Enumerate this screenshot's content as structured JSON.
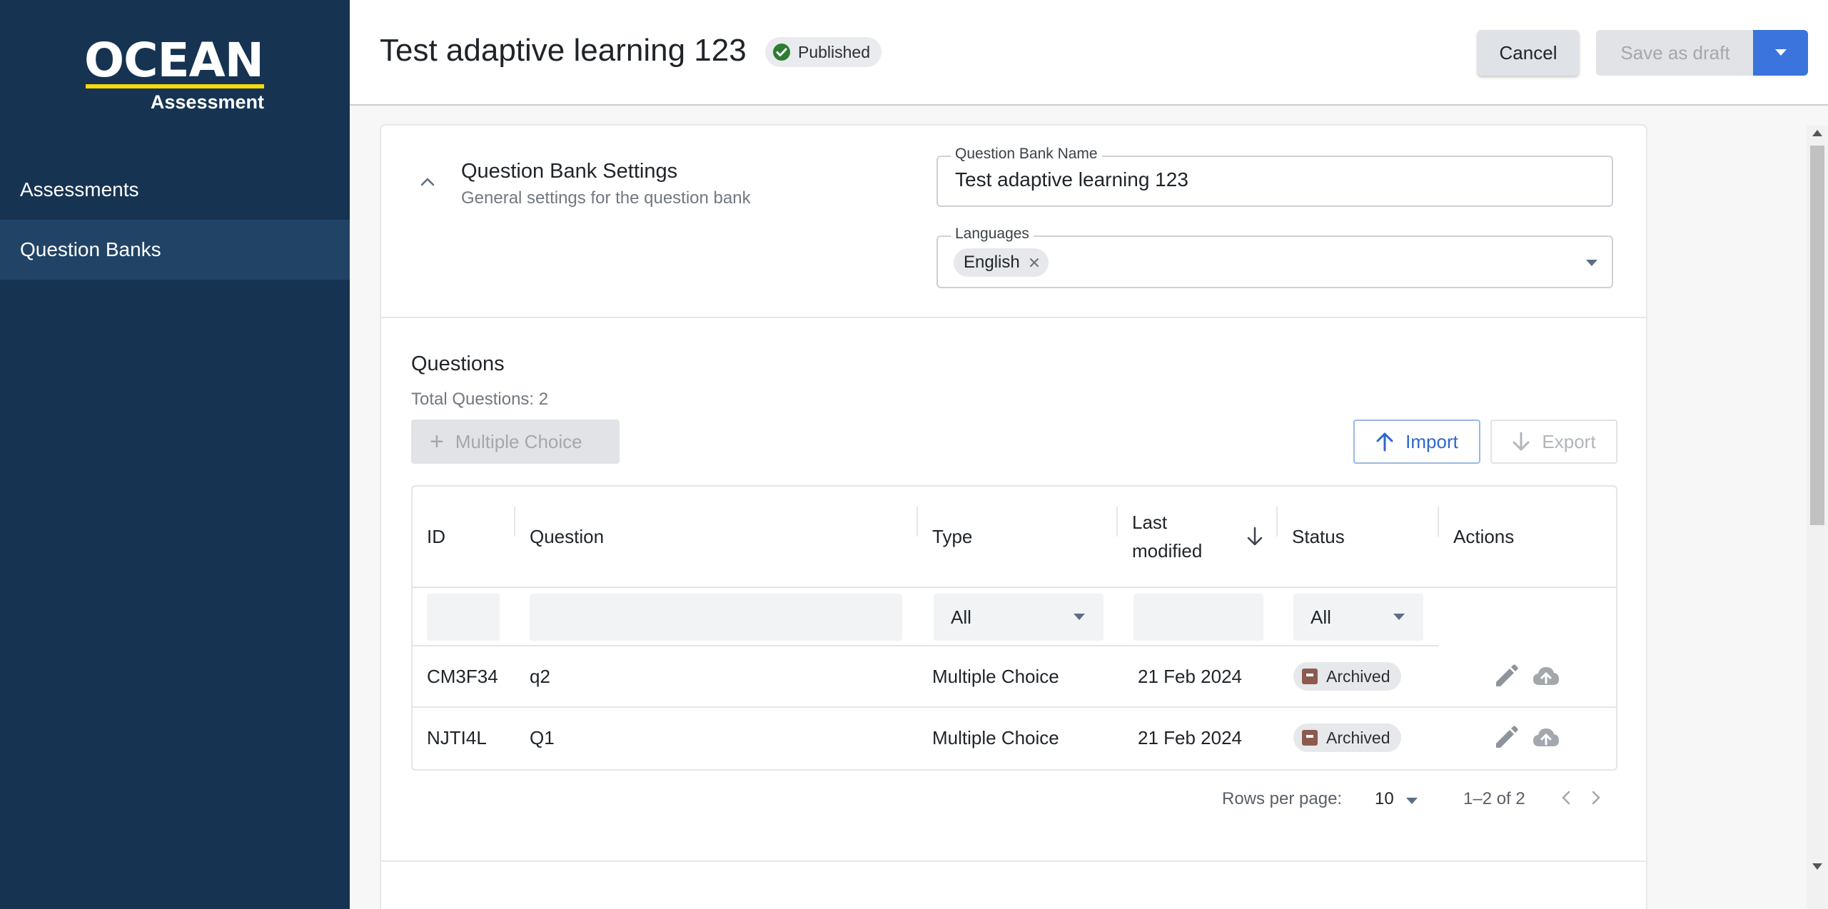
{
  "brand": {
    "name": "OCEAN",
    "sub": "Assessment",
    "accent": "#f5d90b"
  },
  "sidebar": {
    "items": [
      {
        "label": "Assessments",
        "active": false
      },
      {
        "label": "Question Banks",
        "active": true
      }
    ]
  },
  "header": {
    "title": "Test adaptive learning 123",
    "status": "Published",
    "cancel_label": "Cancel",
    "draft_label": "Save as draft"
  },
  "settings": {
    "title": "Question Bank Settings",
    "subtitle": "General settings for the question bank",
    "name_label": "Question Bank Name",
    "name_value": "Test adaptive learning 123",
    "languages_label": "Languages",
    "languages": [
      "English"
    ]
  },
  "questions": {
    "title": "Questions",
    "total": "Total Questions: 2",
    "add_label": "Multiple Choice",
    "import_label": "Import",
    "export_label": "Export",
    "columns": [
      "ID",
      "Question",
      "Type",
      "Last modified",
      "Status",
      "Actions"
    ],
    "filters": {
      "type": "All",
      "status": "All"
    },
    "rows": [
      {
        "id": "CM3F34",
        "question": "q2",
        "type": "Multiple Choice",
        "modified": "21 Feb 2024",
        "status": "Archived"
      },
      {
        "id": "NJTI4L",
        "question": "Q1",
        "type": "Multiple Choice",
        "modified": "21 Feb 2024",
        "status": "Archived"
      }
    ],
    "pager": {
      "rows_label": "Rows per page:",
      "rows_value": "10",
      "range": "1–2 of 2"
    }
  },
  "colors": {
    "sidebar_bg": "#163352",
    "primary": "#3a74dc",
    "published": "#2e7d32",
    "archived": "#8d5a4f"
  }
}
